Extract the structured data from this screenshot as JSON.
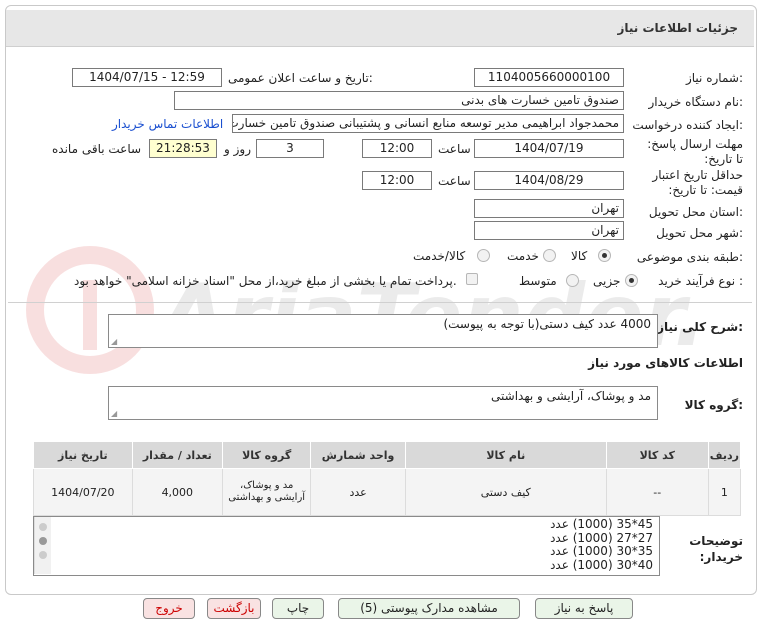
{
  "header": {
    "title": "جزئیات اطلاعات نیاز"
  },
  "fields": {
    "need_number_label": "شماره نیاز:",
    "need_number": "1104005660000100",
    "announce_label": "تاریخ و ساعت اعلان عمومی:",
    "announce_value": "1404/07/15 - 12:59",
    "buyer_org_label": "نام دستگاه خریدار:",
    "buyer_org": "صندوق تامین خسارت های بدنی",
    "creator_label": "ایجاد کننده درخواست:",
    "creator": "محمدجواد ابراهیمی مدیر توسعه منابع انسانی و پشتیبانی صندوق تامین خسارت های بدنی",
    "contact_link": "اطلاعات تماس خریدار",
    "deadline_label": "مهلت ارسال پاسخ: تا تاریخ:",
    "deadline_date": "1404/07/19",
    "time_label": "ساعت",
    "deadline_time": "12:00",
    "days": "3",
    "days_label": "روز و",
    "remaining": "21:28:53",
    "remaining_label": "ساعت باقی مانده",
    "validity_label": "حداقل تاریخ اعتبار قیمت: تا تاریخ:",
    "validity_date": "1404/08/29",
    "validity_time": "12:00",
    "province_label": "استان محل تحویل:",
    "province": "تهران",
    "city_label": "شهر محل تحویل:",
    "city": "تهران",
    "category_label": "طبقه بندی موضوعی:",
    "category_options": [
      "کالا",
      "خدمت",
      "کالا/خدمت"
    ],
    "process_label": "نوع فرآیند خرید :",
    "process_options": [
      "جزیی",
      "متوسط"
    ],
    "payment_note": "پرداخت تمام یا بخشی از مبلغ خرید،از محل \"اسناد خزانه اسلامی\" خواهد بود."
  },
  "summary": {
    "label": "شرح کلی نیاز:",
    "text": "4000 عدد کیف دستی(با توجه به پیوست)"
  },
  "goods_section_title": "اطلاعات کالاهای مورد نیاز",
  "goods_group": {
    "label": "گروه کالا:",
    "value": "مد و پوشاک، آرایشی و بهداشتی"
  },
  "table": {
    "headers": [
      "ردیف",
      "کد کالا",
      "نام کالا",
      "واحد شمارش",
      "گروه کالا",
      "تعداد / مقدار",
      "تاریخ نیاز"
    ],
    "rows": [
      {
        "index": "1",
        "code": "--",
        "name": "کیف دستی",
        "unit": "عدد",
        "group": "مد و پوشاک، آرایشی و بهداشتی",
        "qty": "4,000",
        "date": "1404/07/20"
      }
    ]
  },
  "notes": {
    "label": "توضیحات خریدار:",
    "lines": [
      "45*35 (1000) عدد",
      "27*27 (1000) عدد",
      "35*30 (1000) عدد",
      "40*30 (1000) عدد"
    ]
  },
  "buttons": {
    "reply": "پاسخ به نیاز",
    "docs": "مشاهده مدارک پیوستی (5)",
    "print": "چاپ",
    "back": "بازگشت",
    "exit": "خروج"
  },
  "watermark": {
    "text": "AriaTender.neT"
  },
  "colors": {
    "header_bg": "#e7e7e7",
    "link": "#1a4fd0",
    "remaining_bg": "#ffffd0",
    "exit_text": "#cc0000"
  }
}
